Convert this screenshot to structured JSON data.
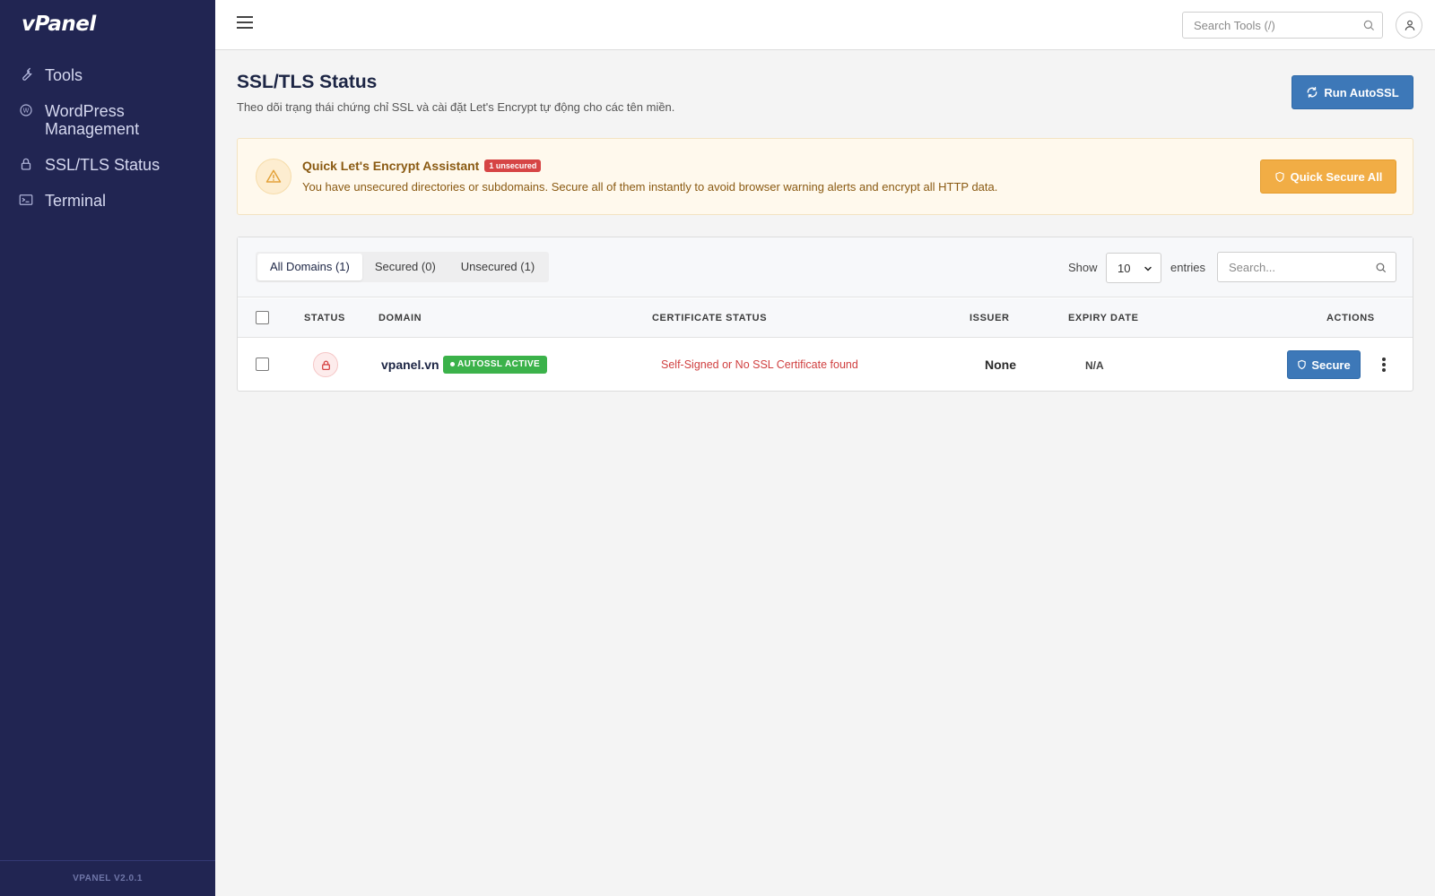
{
  "brand": {
    "logo": "vPanel",
    "version": "VPANEL V2.0.1"
  },
  "sidebar": {
    "items": [
      {
        "label": "Tools",
        "icon": "wrench-icon"
      },
      {
        "label": "WordPress Management",
        "icon": "wordpress-icon"
      },
      {
        "label": "SSL/TLS Status",
        "icon": "lock-icon"
      },
      {
        "label": "Terminal",
        "icon": "terminal-icon"
      }
    ]
  },
  "topbar": {
    "search_placeholder": "Search Tools (/)"
  },
  "page": {
    "title": "SSL/TLS Status",
    "subtitle": "Theo dõi trạng thái chứng chỉ SSL và cài đặt Let's Encrypt tự động cho các tên miền.",
    "run_autossl_label": "Run AutoSSL"
  },
  "alert": {
    "title": "Quick Let's Encrypt Assistant",
    "badge": "1 unsecured",
    "text": "You have unsecured directories or subdomains. Secure all of them instantly to avoid browser warning alerts and encrypt all HTTP data.",
    "button_label": "Quick Secure All"
  },
  "table": {
    "tabs": [
      "All Domains (1)",
      "Secured (0)",
      "Unsecured (1)"
    ],
    "active_tab": 0,
    "show_label": "Show",
    "entries_value": "10",
    "entries_label": "entries",
    "search_placeholder": "Search...",
    "columns": [
      "STATUS",
      "DOMAIN",
      "CERTIFICATE STATUS",
      "ISSUER",
      "EXPIRY DATE",
      "ACTIONS"
    ],
    "rows": [
      {
        "domain": "vpanel.vn",
        "badge": "AUTOSSL ACTIVE",
        "certificate_status": "Self-Signed or No SSL Certificate found",
        "issuer": "None",
        "expiry": "N/A",
        "action_label": "Secure"
      }
    ]
  },
  "colors": {
    "sidebar_bg": "#212552",
    "primary": "#3d78b8",
    "warning": "#f1ad45",
    "danger": "#d64545",
    "success": "#3bb24a"
  }
}
